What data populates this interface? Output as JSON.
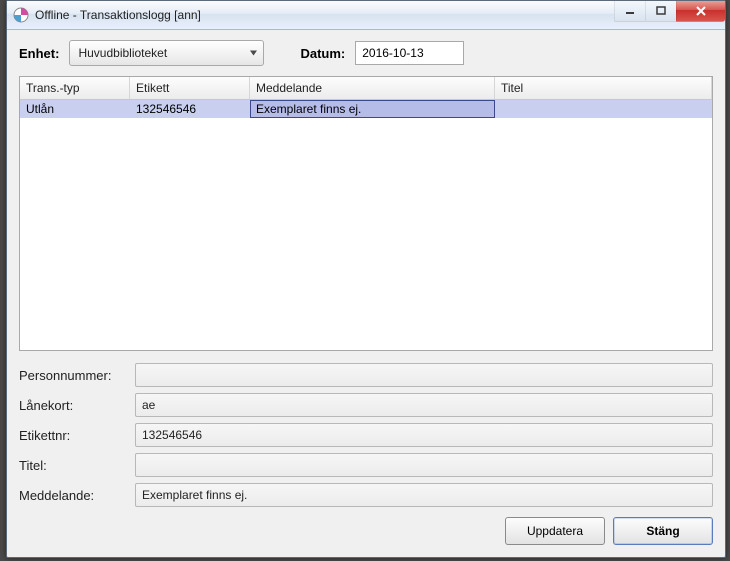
{
  "window": {
    "title": "Offline - Transaktionslogg [ann]"
  },
  "toolbar": {
    "unit_label": "Enhet:",
    "unit_value": "Huvudbiblioteket",
    "date_label": "Datum:",
    "date_value": "2016-10-13"
  },
  "table": {
    "headers": {
      "type": "Trans.-typ",
      "label": "Etikett",
      "message": "Meddelande",
      "title": "Titel"
    },
    "rows": [
      {
        "type": "Utlån",
        "label": "132546546",
        "message": "Exemplaret finns ej.",
        "title": ""
      }
    ]
  },
  "details": {
    "person_label": "Personnummer:",
    "person_value": "",
    "card_label": "Lånekort:",
    "card_value": "ae",
    "labelno_label": "Etikettnr:",
    "labelno_value": "132546546",
    "title_label": "Titel:",
    "title_value": "",
    "message_label": "Meddelande:",
    "message_value": "Exemplaret finns ej."
  },
  "footer": {
    "update_label": "Uppdatera",
    "close_label": "Stäng"
  }
}
